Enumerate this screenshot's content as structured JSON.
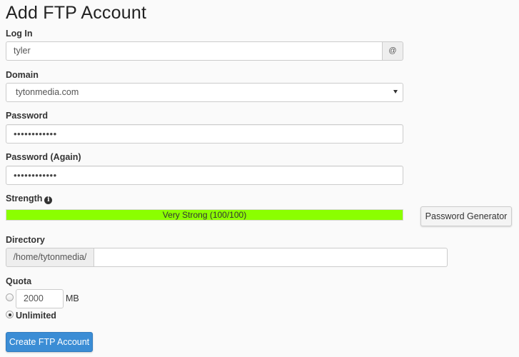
{
  "page": {
    "title": "Add FTP Account"
  },
  "login": {
    "label": "Log In",
    "value": "tyler",
    "addon": "@"
  },
  "domain": {
    "label": "Domain",
    "selected": "tytonmedia.com"
  },
  "password": {
    "label": "Password",
    "value": "••••••••••••"
  },
  "password_again": {
    "label": "Password (Again)",
    "value": "••••••••••••"
  },
  "strength": {
    "label": "Strength",
    "info_icon": "info-circle-icon",
    "text": "Very Strong (100/100)",
    "score": 100,
    "max": 100,
    "color": "#8bff00",
    "generator_label": "Password Generator"
  },
  "directory": {
    "label": "Directory",
    "prefix": "/home/tytonmedia/",
    "value": ""
  },
  "quota": {
    "label": "Quota",
    "limited_value": "2000",
    "unit": "MB",
    "unlimited_label": "Unlimited",
    "selected": "unlimited"
  },
  "actions": {
    "submit_label": "Create FTP Account",
    "primary_color": "#3b8dd5"
  }
}
